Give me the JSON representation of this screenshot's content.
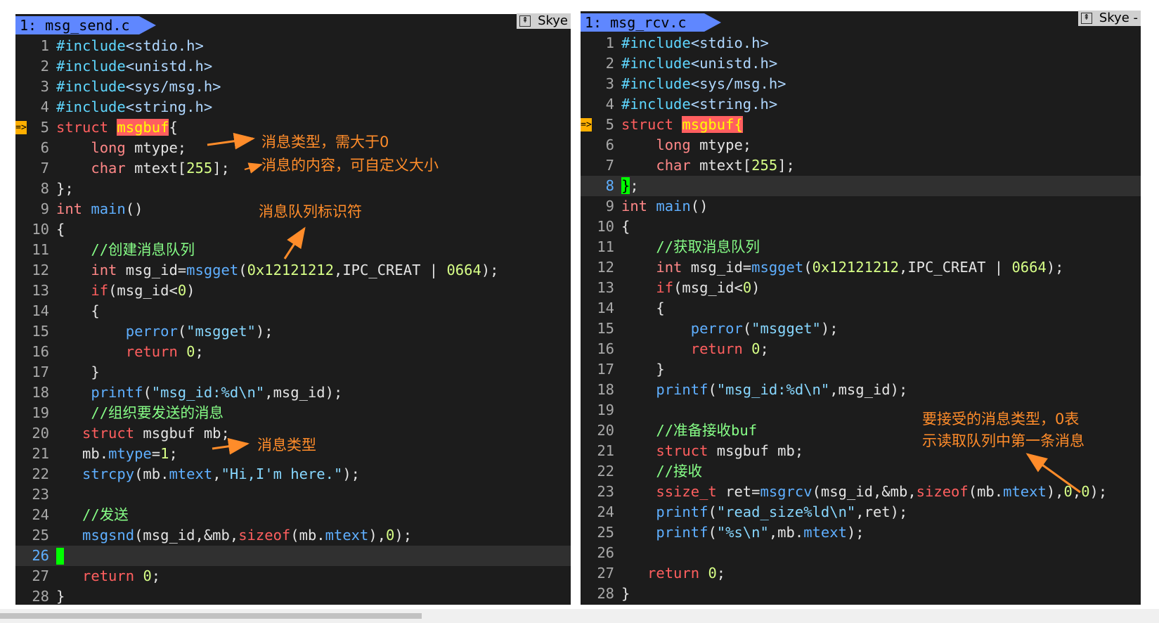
{
  "left": {
    "tab": "1: msg_send.c",
    "tagbar": "Skye",
    "lines": [
      {
        "n": "1",
        "html": [
          [
            "pp",
            "#include"
          ],
          [
            "inc",
            "<stdio.h>"
          ]
        ]
      },
      {
        "n": "2",
        "html": [
          [
            "pp",
            "#include"
          ],
          [
            "inc",
            "<unistd.h>"
          ]
        ]
      },
      {
        "n": "3",
        "html": [
          [
            "pp",
            "#include"
          ],
          [
            "inc",
            "<sys/msg.h>"
          ]
        ]
      },
      {
        "n": "4",
        "html": [
          [
            "pp",
            "#include"
          ],
          [
            "inc",
            "<string.h>"
          ]
        ]
      },
      {
        "n": "5",
        "sign": "=>",
        "html": [
          [
            "kw",
            "struct "
          ],
          [
            "hl",
            "msgbuf"
          ],
          [
            "",
            "{"
          ]
        ]
      },
      {
        "n": "6",
        "html": [
          [
            "",
            "    "
          ],
          [
            "type",
            "long"
          ],
          [
            "",
            " mtype;"
          ]
        ]
      },
      {
        "n": "7",
        "html": [
          [
            "",
            "    "
          ],
          [
            "type",
            "char"
          ],
          [
            "",
            " mtext["
          ],
          [
            "num",
            "255"
          ],
          [
            "",
            "];"
          ]
        ]
      },
      {
        "n": "8",
        "html": [
          [
            "",
            "};"
          ]
        ]
      },
      {
        "n": "9",
        "html": [
          [
            "type",
            "int"
          ],
          [
            "",
            " "
          ],
          [
            "fn",
            "main"
          ],
          [
            "",
            "()"
          ]
        ]
      },
      {
        "n": "10",
        "html": [
          [
            "",
            "{"
          ]
        ]
      },
      {
        "n": "11",
        "html": [
          [
            "",
            "    "
          ],
          [
            "cm",
            "//创建消息队列"
          ]
        ]
      },
      {
        "n": "12",
        "html": [
          [
            "",
            "    "
          ],
          [
            "type",
            "int"
          ],
          [
            "",
            " msg_id="
          ],
          [
            "fn",
            "msgget"
          ],
          [
            "",
            "("
          ],
          [
            "num",
            "0x12121212"
          ],
          [
            "",
            ",IPC_CREAT | "
          ],
          [
            "num",
            "0664"
          ],
          [
            "",
            ");"
          ]
        ]
      },
      {
        "n": "13",
        "html": [
          [
            "",
            "    "
          ],
          [
            "kw",
            "if"
          ],
          [
            "",
            "(msg_id<"
          ],
          [
            "num",
            "0"
          ],
          [
            "",
            ")"
          ]
        ]
      },
      {
        "n": "14",
        "html": [
          [
            "",
            "    {"
          ]
        ]
      },
      {
        "n": "15",
        "html": [
          [
            "",
            "        "
          ],
          [
            "fn",
            "perror"
          ],
          [
            "",
            "("
          ],
          [
            "str",
            "\"msgget\""
          ],
          [
            "",
            ");"
          ]
        ]
      },
      {
        "n": "16",
        "html": [
          [
            "",
            "        "
          ],
          [
            "kw",
            "return"
          ],
          [
            "",
            " "
          ],
          [
            "num",
            "0"
          ],
          [
            "",
            ";"
          ]
        ]
      },
      {
        "n": "17",
        "html": [
          [
            "",
            "    }"
          ]
        ]
      },
      {
        "n": "18",
        "html": [
          [
            "",
            "    "
          ],
          [
            "fn",
            "printf"
          ],
          [
            "",
            "("
          ],
          [
            "str",
            "\"msg_id:%d\\n\""
          ],
          [
            "",
            ",msg_id);"
          ]
        ]
      },
      {
        "n": "19",
        "html": [
          [
            "",
            "    "
          ],
          [
            "cm",
            "//组织要发送的消息"
          ]
        ]
      },
      {
        "n": "20",
        "html": [
          [
            "",
            "   "
          ],
          [
            "kw",
            "struct"
          ],
          [
            "",
            " msgbuf mb;"
          ]
        ]
      },
      {
        "n": "21",
        "html": [
          [
            "",
            "   mb."
          ],
          [
            "fn",
            "mtype"
          ],
          [
            "",
            "="
          ],
          [
            "num",
            "1"
          ],
          [
            "",
            ";"
          ]
        ]
      },
      {
        "n": "22",
        "html": [
          [
            "",
            "   "
          ],
          [
            "fn",
            "strcpy"
          ],
          [
            "",
            "(mb."
          ],
          [
            "fn",
            "mtext"
          ],
          [
            "",
            ","
          ],
          [
            "str",
            "\"Hi,I'm here.\""
          ],
          [
            "",
            ");"
          ]
        ]
      },
      {
        "n": "23",
        "html": []
      },
      {
        "n": "24",
        "html": [
          [
            "",
            "   "
          ],
          [
            "cm",
            "//发送"
          ]
        ]
      },
      {
        "n": "25",
        "html": [
          [
            "",
            "   "
          ],
          [
            "fn",
            "msgsnd"
          ],
          [
            "",
            "(msg_id,&mb,"
          ],
          [
            "kw",
            "sizeof"
          ],
          [
            "",
            "(mb."
          ],
          [
            "fn",
            "mtext"
          ],
          [
            "",
            "),"
          ],
          [
            "num",
            "0"
          ],
          [
            "",
            ");"
          ]
        ]
      },
      {
        "n": "26",
        "cursorline": true,
        "cursor": true,
        "html": []
      },
      {
        "n": "27",
        "html": [
          [
            "",
            "   "
          ],
          [
            "kw",
            "return"
          ],
          [
            "",
            " "
          ],
          [
            "num",
            "0"
          ],
          [
            "",
            ";"
          ]
        ]
      },
      {
        "n": "28",
        "html": [
          [
            "",
            "}"
          ]
        ]
      }
    ],
    "annotations": {
      "a1": "消息类型，需大于0",
      "a2": "消息的内容，可自定义大小",
      "a3": "消息队列标识符",
      "a4": "消息类型"
    }
  },
  "right": {
    "tab": "1: msg_rcv.c",
    "tagbar": "Skye -",
    "lines": [
      {
        "n": "1",
        "html": [
          [
            "pp",
            "#include"
          ],
          [
            "inc",
            "<stdio.h>"
          ]
        ]
      },
      {
        "n": "2",
        "html": [
          [
            "pp",
            "#include"
          ],
          [
            "inc",
            "<unistd.h>"
          ]
        ]
      },
      {
        "n": "3",
        "html": [
          [
            "pp",
            "#include"
          ],
          [
            "inc",
            "<sys/msg.h>"
          ]
        ]
      },
      {
        "n": "4",
        "html": [
          [
            "pp",
            "#include"
          ],
          [
            "inc",
            "<string.h>"
          ]
        ]
      },
      {
        "n": "5",
        "sign": "=>",
        "html": [
          [
            "kw",
            "struct "
          ],
          [
            "hl",
            "msgbuf"
          ],
          [
            "match",
            "{"
          ]
        ]
      },
      {
        "n": "6",
        "html": [
          [
            "",
            "    "
          ],
          [
            "type",
            "long"
          ],
          [
            "",
            " mtype;"
          ]
        ]
      },
      {
        "n": "7",
        "html": [
          [
            "",
            "    "
          ],
          [
            "type",
            "char"
          ],
          [
            "",
            " mtext["
          ],
          [
            "num",
            "255"
          ],
          [
            "",
            "];"
          ]
        ]
      },
      {
        "n": "8",
        "cursorline": true,
        "html": [
          [
            "green",
            "}"
          ],
          [
            "",
            ";"
          ]
        ]
      },
      {
        "n": "9",
        "html": [
          [
            "type",
            "int"
          ],
          [
            "",
            " "
          ],
          [
            "fn",
            "main"
          ],
          [
            "",
            "()"
          ]
        ]
      },
      {
        "n": "10",
        "html": [
          [
            "",
            "{"
          ]
        ]
      },
      {
        "n": "11",
        "html": [
          [
            "",
            "    "
          ],
          [
            "cm",
            "//获取消息队列"
          ]
        ]
      },
      {
        "n": "12",
        "html": [
          [
            "",
            "    "
          ],
          [
            "type",
            "int"
          ],
          [
            "",
            " msg_id="
          ],
          [
            "fn",
            "msgget"
          ],
          [
            "",
            "("
          ],
          [
            "num",
            "0x12121212"
          ],
          [
            "",
            ",IPC_CREAT | "
          ],
          [
            "num",
            "0664"
          ],
          [
            "",
            ");"
          ]
        ]
      },
      {
        "n": "13",
        "html": [
          [
            "",
            "    "
          ],
          [
            "kw",
            "if"
          ],
          [
            "",
            "(msg_id<"
          ],
          [
            "num",
            "0"
          ],
          [
            "",
            ")"
          ]
        ]
      },
      {
        "n": "14",
        "html": [
          [
            "",
            "    {"
          ]
        ]
      },
      {
        "n": "15",
        "html": [
          [
            "",
            "        "
          ],
          [
            "fn",
            "perror"
          ],
          [
            "",
            "("
          ],
          [
            "str",
            "\"msgget\""
          ],
          [
            "",
            ");"
          ]
        ]
      },
      {
        "n": "16",
        "html": [
          [
            "",
            "        "
          ],
          [
            "kw",
            "return"
          ],
          [
            "",
            " "
          ],
          [
            "num",
            "0"
          ],
          [
            "",
            ";"
          ]
        ]
      },
      {
        "n": "17",
        "html": [
          [
            "",
            "    }"
          ]
        ]
      },
      {
        "n": "18",
        "html": [
          [
            "",
            "    "
          ],
          [
            "fn",
            "printf"
          ],
          [
            "",
            "("
          ],
          [
            "str",
            "\"msg_id:%d\\n\""
          ],
          [
            "",
            ",msg_id);"
          ]
        ]
      },
      {
        "n": "19",
        "html": []
      },
      {
        "n": "20",
        "html": [
          [
            "",
            "    "
          ],
          [
            "cm",
            "//准备接收buf"
          ]
        ]
      },
      {
        "n": "21",
        "html": [
          [
            "",
            "    "
          ],
          [
            "kw",
            "struct"
          ],
          [
            "",
            " msgbuf mb;"
          ]
        ]
      },
      {
        "n": "22",
        "html": [
          [
            "",
            "    "
          ],
          [
            "cm",
            "//接收"
          ]
        ]
      },
      {
        "n": "23",
        "html": [
          [
            "",
            "    "
          ],
          [
            "kw",
            "ssize_t"
          ],
          [
            "",
            " ret="
          ],
          [
            "fn",
            "msgrcv"
          ],
          [
            "",
            "(msg_id,&mb,"
          ],
          [
            "kw",
            "sizeof"
          ],
          [
            "",
            "(mb."
          ],
          [
            "fn",
            "mtext"
          ],
          [
            "",
            "),"
          ],
          [
            "num",
            "0"
          ],
          [
            "",
            ","
          ],
          [
            "num",
            "0"
          ],
          [
            "",
            ");"
          ]
        ]
      },
      {
        "n": "24",
        "html": [
          [
            "",
            "    "
          ],
          [
            "fn",
            "printf"
          ],
          [
            "",
            "("
          ],
          [
            "str",
            "\"read_size%ld\\n\""
          ],
          [
            "",
            ",ret);"
          ]
        ]
      },
      {
        "n": "25",
        "html": [
          [
            "",
            "    "
          ],
          [
            "fn",
            "printf"
          ],
          [
            "",
            "("
          ],
          [
            "str",
            "\"%s\\n\""
          ],
          [
            "",
            ",mb."
          ],
          [
            "fn",
            "mtext"
          ],
          [
            "",
            ");"
          ]
        ]
      },
      {
        "n": "26",
        "html": []
      },
      {
        "n": "27",
        "html": [
          [
            "",
            "   "
          ],
          [
            "kw",
            "return"
          ],
          [
            "",
            " "
          ],
          [
            "num",
            "0"
          ],
          [
            "",
            ";"
          ]
        ]
      },
      {
        "n": "28",
        "html": [
          [
            "",
            "}"
          ]
        ]
      }
    ],
    "annotations": {
      "a1": "要接受的消息类型，0表",
      "a2": "示读取队列中第一条消息"
    }
  },
  "colors": {
    "accent": "#ff8c2a",
    "tab": "#5f87ff",
    "editor_bg": "#1c1c1c"
  }
}
